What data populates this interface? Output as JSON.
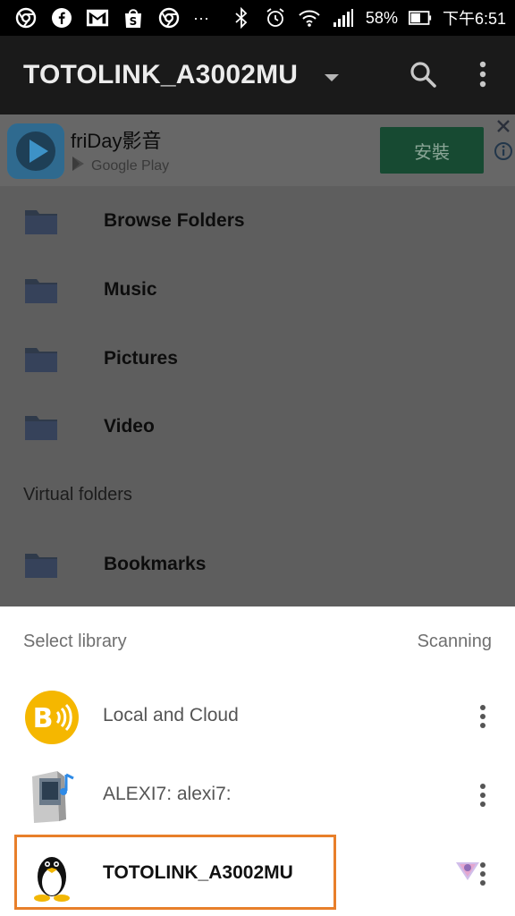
{
  "status_bar": {
    "battery": "58%",
    "time": "下午6:51",
    "dots": "···",
    "icons": [
      "chrome-icon",
      "facebook-icon",
      "gmail-icon",
      "shopee-icon",
      "chrome-icon",
      "bluetooth-icon",
      "alarm-icon",
      "wifi-icon",
      "signal-icon",
      "battery-icon"
    ]
  },
  "app_bar": {
    "title": "TOTOLINK_A3002MU",
    "icons": [
      "dropdown-icon",
      "search-icon",
      "more-vert-icon"
    ]
  },
  "ad": {
    "app_name": "friDay影音",
    "store": "Google Play",
    "install_label": "安裝",
    "brand_color": "#2e7fb0",
    "button_color": "#1e8a53"
  },
  "folders": [
    {
      "label": "Browse Folders"
    },
    {
      "label": "Music"
    },
    {
      "label": "Pictures"
    },
    {
      "label": "Video"
    }
  ],
  "virtual_section": {
    "label": "Virtual folders",
    "items": [
      {
        "label": "Bookmarks"
      }
    ]
  },
  "sheet": {
    "title": "Select library",
    "status": "Scanning",
    "libraries": [
      {
        "label": "Local and Cloud",
        "icon": "bubbleupnp-icon"
      },
      {
        "label": "ALEXI7: alexi7:",
        "icon": "media-server-icon"
      },
      {
        "label": "TOTOLINK_A3002MU",
        "icon": "linux-tux-icon",
        "selected": true
      }
    ],
    "highlight_color": "#e87f2a"
  }
}
